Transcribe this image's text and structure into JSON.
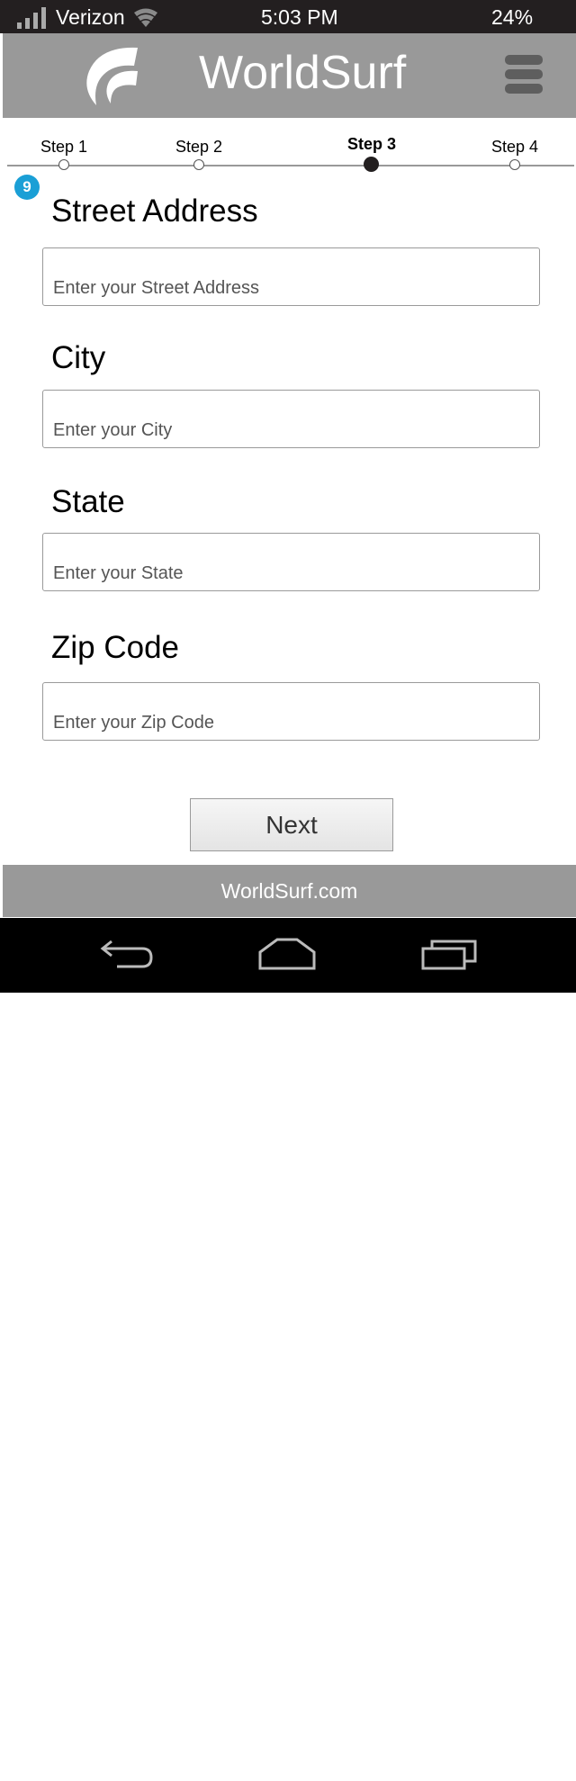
{
  "status_bar": {
    "carrier": "Verizon",
    "time": "5:03 PM",
    "battery": "24%",
    "icons": [
      "signal-icon",
      "wifi-icon"
    ]
  },
  "header": {
    "title": "WorldSurf",
    "icons": [
      "logo-icon",
      "menu-icon"
    ]
  },
  "stepper": {
    "steps": [
      {
        "label": "Step 1",
        "active": false
      },
      {
        "label": "Step 2",
        "active": false
      },
      {
        "label": "Step 3",
        "active": true
      },
      {
        "label": "Step 4",
        "active": false
      }
    ]
  },
  "badge": "9",
  "form": {
    "street": {
      "label": "Street Address",
      "placeholder": "Enter your Street Address",
      "value": ""
    },
    "city": {
      "label": "City",
      "placeholder": "Enter your City",
      "value": ""
    },
    "state": {
      "label": "State",
      "placeholder": "Enter your State",
      "value": ""
    },
    "zip": {
      "label": "Zip Code",
      "placeholder": "Enter your Zip Code",
      "value": ""
    }
  },
  "next_label": "Next",
  "footer": "WorldSurf.com",
  "nav": {
    "icons": [
      "back-icon",
      "home-icon",
      "recents-icon"
    ]
  },
  "colors": {
    "header_bg": "#999999",
    "status_bg": "#231f20",
    "badge": "#1a9fd6"
  }
}
